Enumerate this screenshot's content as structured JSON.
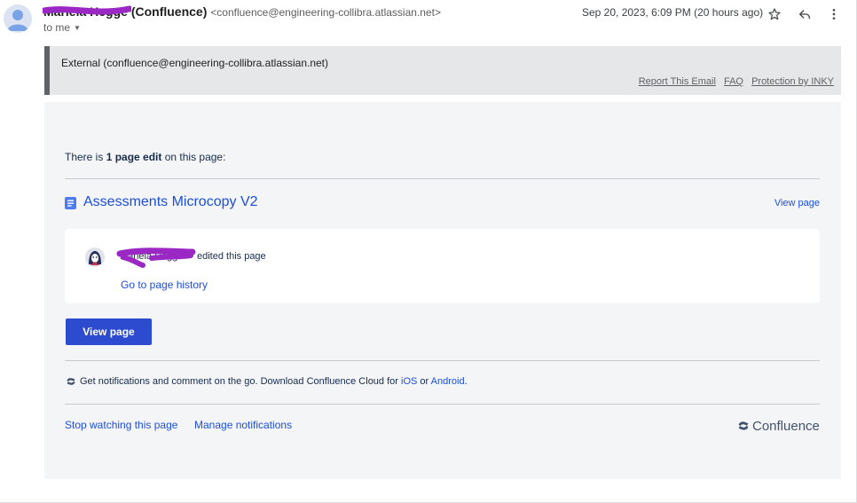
{
  "email": {
    "sender_name": "Mariela Hegge (Confluence)",
    "sender_email": "<confluence@engineering-collibra.atlassian.net>",
    "to_line": "to me",
    "date": "Sep 20, 2023, 6:09 PM (20 hours ago)",
    "icons": [
      "star-icon",
      "reply-icon",
      "more-vert-icon"
    ]
  },
  "banner": {
    "text": "External (confluence@engineering-collibra.atlassian.net)",
    "links": [
      "Report This Email",
      "FAQ",
      "Protection by INKY"
    ]
  },
  "body": {
    "summary_prefix": "There is ",
    "summary_bold": "1 page edit",
    "summary_suffix": " on this page:",
    "page_title": "Assessments Microcopy V2",
    "view_page_link": "View page",
    "editor_name": "Mariela Hegge",
    "edited_text": "edited this page",
    "history_link": "Go to page history",
    "button_label": "View page",
    "notify_prefix": "Get notifications and comment on the go. Download Confluence Cloud for ",
    "notify_ios": "iOS",
    "notify_or": " or ",
    "notify_android": "Android",
    "notify_suffix": "."
  },
  "footer": {
    "stop_watching": "Stop watching this page",
    "manage_notifications": "Manage notifications",
    "brand": "Confluence"
  },
  "colors": {
    "link": "#1d4ed8",
    "button": "#2c4bcf",
    "redaction": "#9b27c4"
  }
}
